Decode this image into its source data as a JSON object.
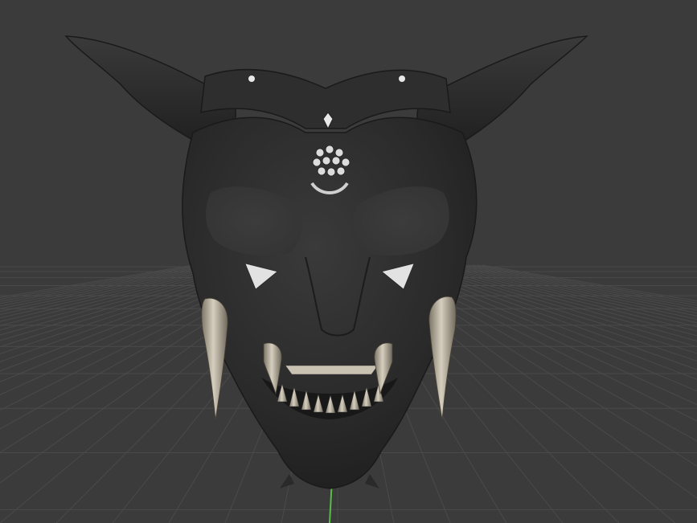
{
  "viewport": {
    "background": "#3b3b3b",
    "grid_color": "#4a4a4a",
    "axis_y_color": "#5dbb4a",
    "model": {
      "name": "demon-mask",
      "base_color": "#2b2b2b",
      "metal_color": "#b9b2a2",
      "ornament_color": "#e8e8e8"
    }
  }
}
